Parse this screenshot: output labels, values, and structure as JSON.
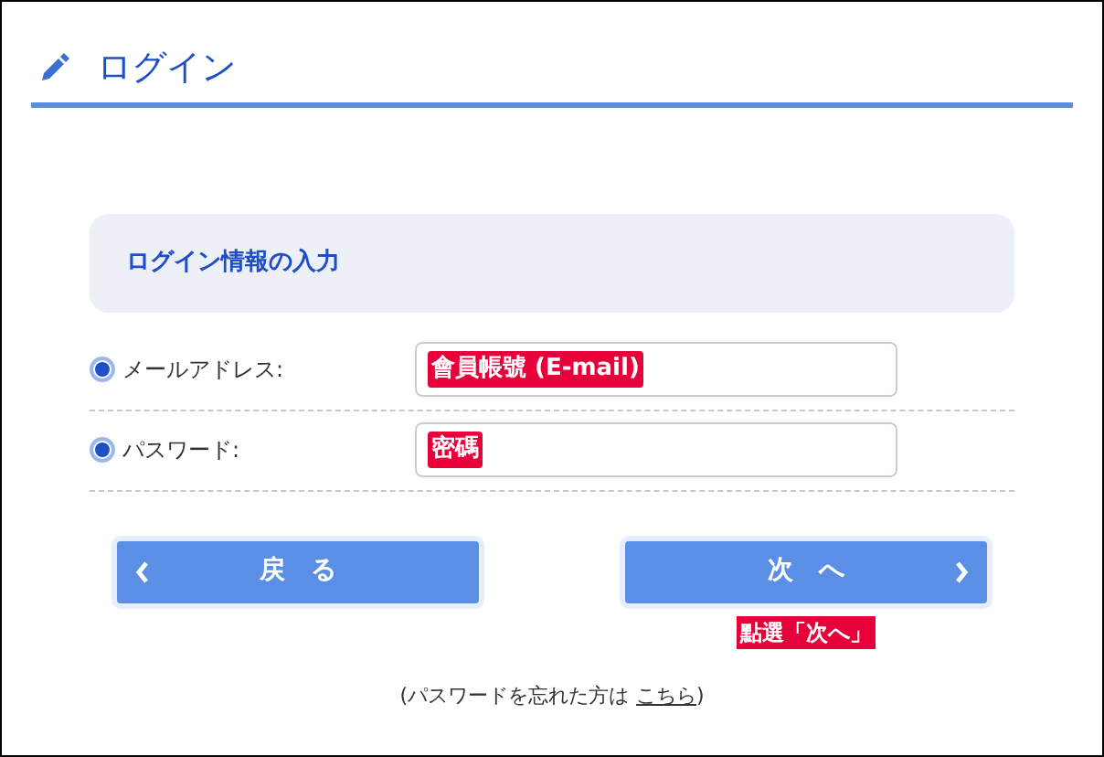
{
  "title": "ログイン",
  "section": {
    "title": "ログイン情報の入力"
  },
  "fields": [
    {
      "label": "メールアドレス:",
      "selected": true,
      "annotation": "會員帳號 (E-mail)"
    },
    {
      "label": "パスワード:",
      "selected": true,
      "annotation": "密碼"
    }
  ],
  "buttons": [
    {
      "label": "戻　る",
      "kind": "back"
    },
    {
      "label": "次　へ",
      "kind": "next"
    }
  ],
  "next_annotation": "點選「次へ」",
  "footer": {
    "before": "(パスワードを忘れた方は",
    "link": "こちら",
    "after": ")"
  }
}
